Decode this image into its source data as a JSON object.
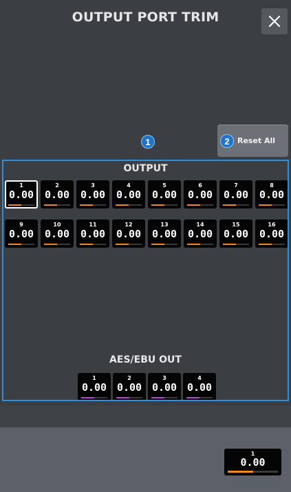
{
  "window": {
    "title": "OUTPUT PORT TRIM",
    "close_icon": "close-icon"
  },
  "callouts": {
    "one": "1",
    "two": "2"
  },
  "toolbar": {
    "reset_all_label": "Reset All"
  },
  "output": {
    "label": "OUTPUT",
    "accent_color": "#f08a1c",
    "channels": [
      {
        "number": "1",
        "value": "0.00",
        "level": 0.5,
        "selected": true
      },
      {
        "number": "2",
        "value": "0.00",
        "level": 0.5
      },
      {
        "number": "3",
        "value": "0.00",
        "level": 0.5
      },
      {
        "number": "4",
        "value": "0.00",
        "level": 0.5
      },
      {
        "number": "5",
        "value": "0.00",
        "level": 0.5
      },
      {
        "number": "6",
        "value": "0.00",
        "level": 0.5
      },
      {
        "number": "7",
        "value": "0.00",
        "level": 0.5
      },
      {
        "number": "8",
        "value": "0.00",
        "level": 0.5
      },
      {
        "number": "9",
        "value": "0.00",
        "level": 0.5
      },
      {
        "number": "10",
        "value": "0.00",
        "level": 0.5
      },
      {
        "number": "11",
        "value": "0.00",
        "level": 0.5
      },
      {
        "number": "12",
        "value": "0.00",
        "level": 0.5
      },
      {
        "number": "13",
        "value": "0.00",
        "level": 0.5
      },
      {
        "number": "14",
        "value": "0.00",
        "level": 0.5
      },
      {
        "number": "15",
        "value": "0.00",
        "level": 0.5
      },
      {
        "number": "16",
        "value": "0.00",
        "level": 0.5
      }
    ]
  },
  "aes_ebu": {
    "label": "AES/EBU OUT",
    "accent_color": "#b844d8",
    "channels": [
      {
        "number": "1",
        "value": "0.00",
        "level": 0.5
      },
      {
        "number": "2",
        "value": "0.00",
        "level": 0.5
      },
      {
        "number": "3",
        "value": "0.00",
        "level": 0.5
      },
      {
        "number": "4",
        "value": "0.00",
        "level": 0.5
      }
    ]
  },
  "selected_channel": {
    "number": "1",
    "value": "0.00",
    "level": 0.5,
    "accent_color": "#f08a1c"
  }
}
